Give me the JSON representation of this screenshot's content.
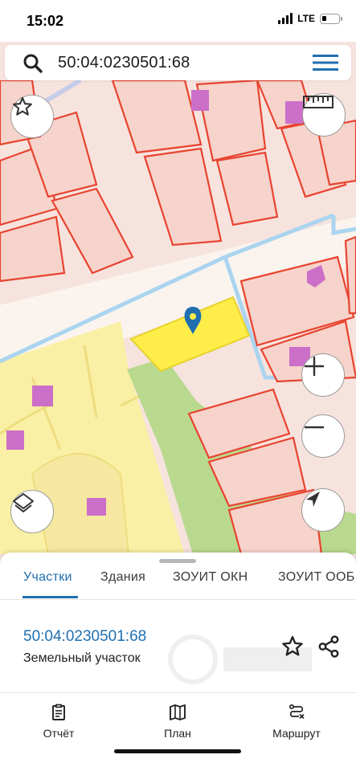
{
  "status_bar": {
    "time": "15:02",
    "network": "LTE",
    "battery_level": 0.3
  },
  "search": {
    "query": "50:04:0230501:68"
  },
  "map": {
    "buttons": [
      "favorite-star",
      "ruler",
      "zoom-in",
      "zoom-out",
      "layers",
      "my-location"
    ],
    "colors": {
      "background": "#f7e3de",
      "parcel_border": "#e8432f",
      "selected_parcel_fill": "#ffee4a",
      "zone_yellow": "#faf0a5",
      "green_area": "#b9d98f",
      "road": "#aad4ef",
      "building": "#cc6fc8"
    }
  },
  "sheet": {
    "tabs": [
      {
        "label": "Участки",
        "active": true
      },
      {
        "label": "Здания",
        "active": false
      },
      {
        "label": "ЗОУИТ ОКН",
        "active": false
      },
      {
        "label": "ЗОУИТ ООБ",
        "active": false
      }
    ],
    "parcel": {
      "number": "50:04:0230501:68",
      "type": "Земельный участок"
    }
  },
  "bottom_nav": [
    {
      "label": "Отчёт",
      "icon": "report-icon"
    },
    {
      "label": "План",
      "icon": "map-plan-icon"
    },
    {
      "label": "Маршрут",
      "icon": "route-icon"
    }
  ],
  "accent_color": "#1f6fb0"
}
